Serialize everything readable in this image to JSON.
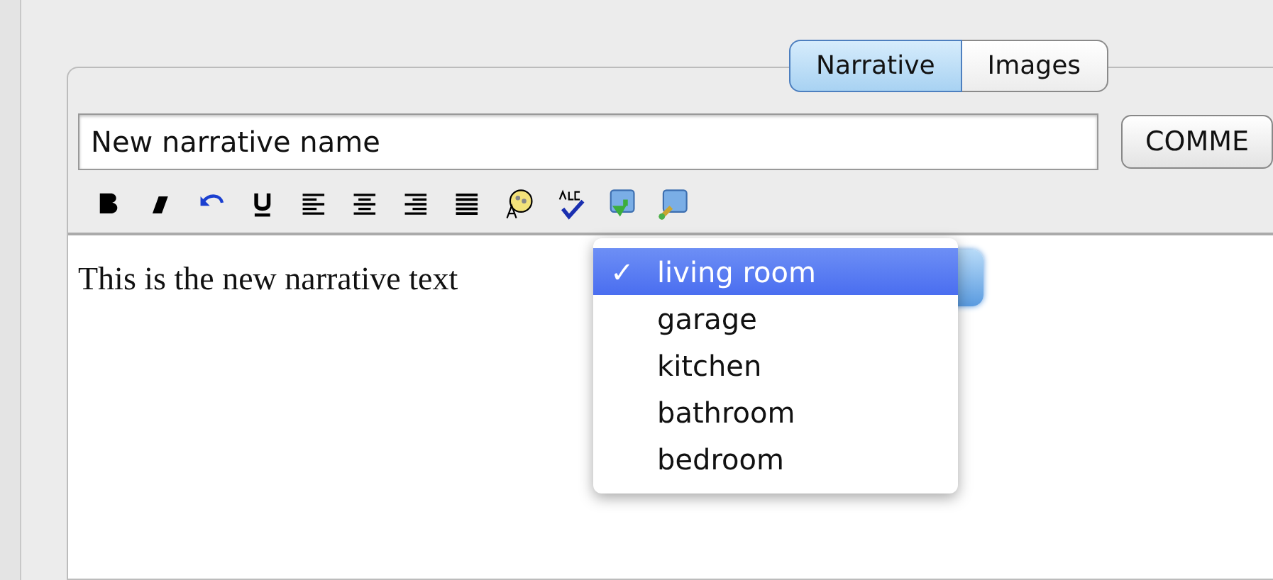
{
  "tabs": [
    {
      "label": "Narrative",
      "selected": true
    },
    {
      "label": "Images",
      "selected": false
    }
  ],
  "name_field": {
    "value": "New narrative name"
  },
  "comment_button": {
    "label": "COMME"
  },
  "editor": {
    "text": "This is the new narrative text"
  },
  "dropdown_menu": {
    "check_mark": "✓",
    "items": [
      {
        "label": "living room",
        "selected": true
      },
      {
        "label": "garage",
        "selected": false
      },
      {
        "label": "kitchen",
        "selected": false
      },
      {
        "label": "bathroom",
        "selected": false
      },
      {
        "label": "bedroom",
        "selected": false
      }
    ]
  }
}
